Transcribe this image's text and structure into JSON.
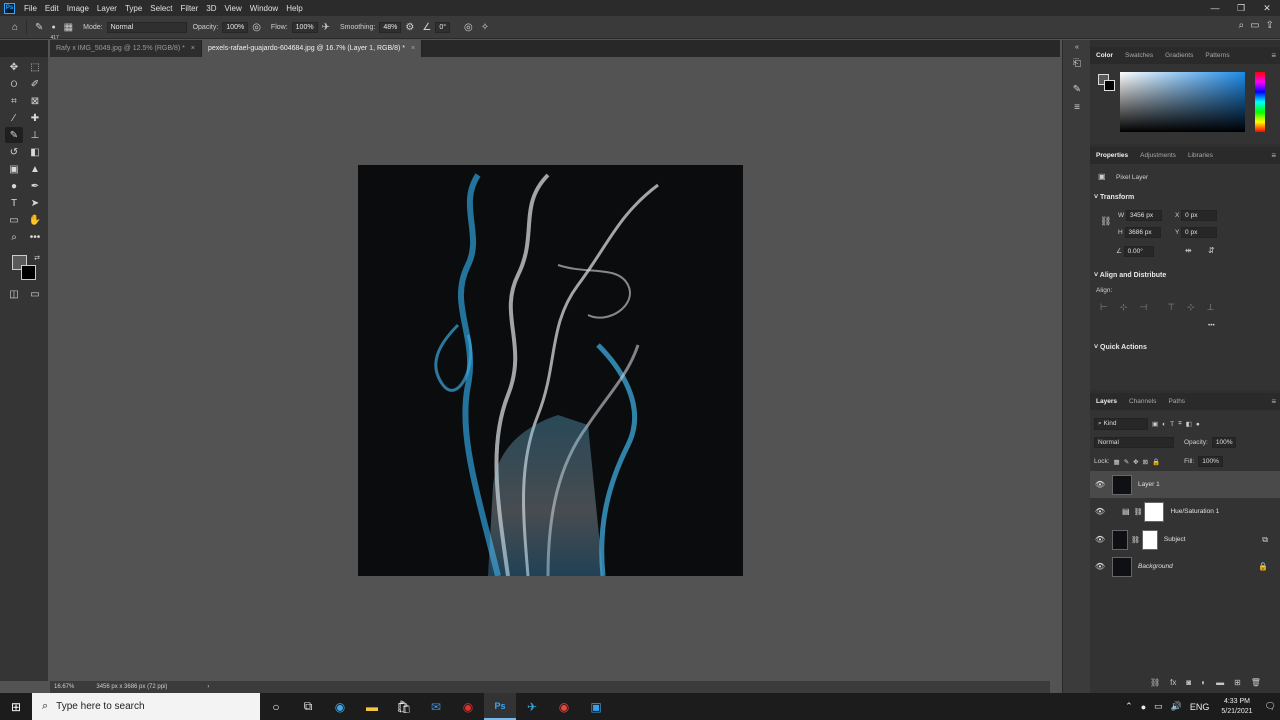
{
  "menu": {
    "app_icon": "Ps",
    "items": [
      "File",
      "Edit",
      "Image",
      "Layer",
      "Type",
      "Select",
      "Filter",
      "3D",
      "View",
      "Window",
      "Help"
    ]
  },
  "options": {
    "brush_size": "417",
    "mode_label": "Mode:",
    "mode_value": "Normal",
    "opacity_label": "Opacity:",
    "opacity_value": "100%",
    "flow_label": "Flow:",
    "flow_value": "100%",
    "smoothing_label": "Smoothing:",
    "smoothing_value": "48%",
    "angle_value": "0°"
  },
  "tabs": [
    {
      "label": "Rafy x IMG_5049.jpg @ 12.5% (RGB/8) *",
      "close": "×"
    },
    {
      "label": "pexels-rafael-guajardo-604684.jpg @ 16.7% (Layer 1, RGB/8) *",
      "close": "×"
    }
  ],
  "status": {
    "zoom": "16.67%",
    "doc_info": "3456 px x 3686 px (72 ppi)",
    "arrow": "›"
  },
  "color_panel": {
    "tabs": [
      "Color",
      "Swatches",
      "Gradients",
      "Patterns"
    ]
  },
  "properties": {
    "tabs": [
      "Properties",
      "Adjustments",
      "Libraries"
    ],
    "layer_type": "Pixel Layer",
    "transform_title": "Transform",
    "w_label": "W",
    "w_value": "3456 px",
    "h_label": "H",
    "h_value": "3686 px",
    "x_label": "X",
    "x_value": "0 px",
    "y_label": "Y",
    "y_value": "0 px",
    "angle_value": "0.00°",
    "align_title": "Align and Distribute",
    "align_label": "Align:",
    "more": "•••",
    "quick_title": "Quick Actions"
  },
  "layers": {
    "tabs": [
      "Layers",
      "Channels",
      "Paths"
    ],
    "filter_label": "Kind",
    "blend": "Normal",
    "opacity_label": "Opacity:",
    "opacity_value": "100%",
    "lock_label": "Lock:",
    "fill_label": "Fill:",
    "fill_value": "100%",
    "items": [
      {
        "name": "Layer 1"
      },
      {
        "name": "Hue/Saturation 1"
      },
      {
        "name": "Subject"
      },
      {
        "name": "Background"
      }
    ]
  },
  "taskbar": {
    "search_placeholder": "Type here to search",
    "time": "4:33 PM",
    "date": "5/21/2021"
  }
}
